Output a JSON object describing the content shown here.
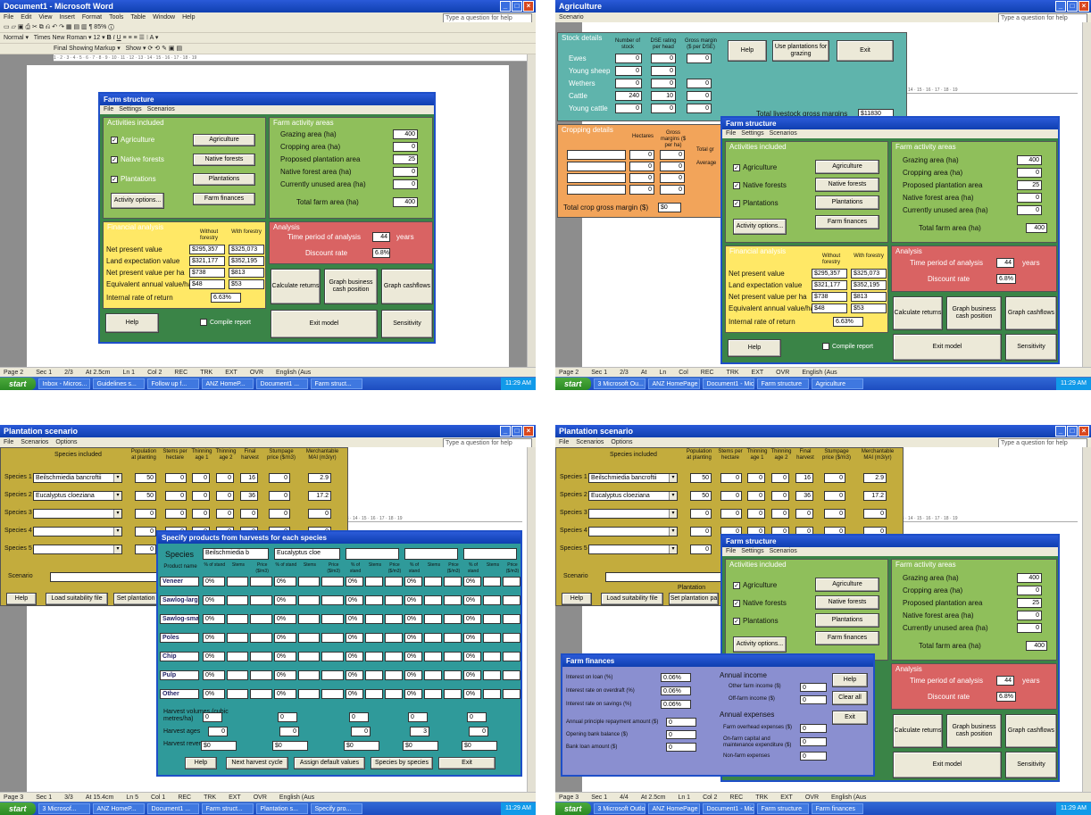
{
  "q1": {
    "title": "Document1 - Microsoft Word",
    "menu": [
      "File",
      "Edit",
      "View",
      "Insert",
      "Format",
      "Tools",
      "Table",
      "Window",
      "Help"
    ],
    "help_box": "Type a question for help",
    "toolbar_font": "Times New Roman",
    "toolbar_size": "12",
    "style": "Normal",
    "zoom": "85%",
    "markup": "Final Showing Markup",
    "show": "Show",
    "status": [
      "Page 2",
      "Sec 1",
      "2/3",
      "At 2.5cm",
      "Ln 1",
      "Col 2",
      "REC",
      "TRK",
      "EXT",
      "OVR",
      "English (Aus"
    ],
    "taskbar": [
      "start",
      "Inbox - Micros...",
      "Guidelines s...",
      "Follow up f...",
      "ANZ HomeP...",
      "Document1 ...",
      "Farm struct..."
    ],
    "clock": "11:29 AM"
  },
  "q2": {
    "title": "Agriculture",
    "scenario": "Scenario",
    "help_box": "Type a question for help",
    "stock_title": "Stock details",
    "stock_headers": [
      "Number of stock",
      "DSE rating per head",
      "Gross margin ($ per DSE)"
    ],
    "stock": [
      {
        "name": "Ewes",
        "v": [
          "0",
          "0",
          "0"
        ]
      },
      {
        "name": "Young sheep",
        "v": [
          "0",
          "0",
          ""
        ]
      },
      {
        "name": "Wethers",
        "v": [
          "0",
          "0",
          "0"
        ]
      },
      {
        "name": "Cattle",
        "v": [
          "240",
          "10",
          "0"
        ]
      },
      {
        "name": "Young cattle",
        "v": [
          "0",
          "0",
          "0"
        ]
      }
    ],
    "btn_help": "Help",
    "btn_use": "Use plantations for grazing",
    "btn_exit": "Exit",
    "total_livestock": "Total livestock gross margins",
    "total_livestock_val": "$11830",
    "crop_title": "Cropping details",
    "crop_headers": [
      "Hectares",
      "Gross margins ($ per ha)"
    ],
    "crop_rows": [
      [
        "0",
        "0"
      ],
      [
        "0",
        "0"
      ],
      [
        "0",
        "0"
      ],
      [
        "0",
        "0"
      ],
      [
        "0",
        "0"
      ]
    ],
    "total_crop": "Total crop gross margin ($)",
    "total_crop_val": "$0",
    "total_g": "Total gr",
    "average": "Average",
    "status": [
      "Page 2",
      "Sec 1",
      "2/3",
      "At",
      "Ln",
      "Col",
      "REC",
      "TRK",
      "EXT",
      "OVR",
      "English (Aus"
    ],
    "taskbar": [
      "start",
      "3 Microsoft Ou...",
      "ANZ HomePage ...",
      "Document1 - Mic...",
      "Farm structure",
      "Agriculture"
    ],
    "clock": "11:29 AM"
  },
  "farm": {
    "title": "Farm structure",
    "menu": [
      "File",
      "Settings",
      "Scenarios"
    ],
    "activities_title": "Activities included",
    "activities": [
      {
        "label": "Agriculture",
        "btn": "Agriculture"
      },
      {
        "label": "Native forests",
        "btn": "Native forests"
      },
      {
        "label": "Plantations",
        "btn": "Plantations"
      }
    ],
    "btn_options": "Activity options...",
    "btn_finances": "Farm finances",
    "areas_title": "Farm activity areas",
    "areas": [
      {
        "label": "Grazing area (ha)",
        "v": "400"
      },
      {
        "label": "Cropping area (ha)",
        "v": "0"
      },
      {
        "label": "Proposed plantation area",
        "v": "25"
      },
      {
        "label": "Native forest area (ha)",
        "v": "0"
      },
      {
        "label": "Currently unused area (ha)",
        "v": "0"
      }
    ],
    "total_area": "Total farm area (ha)",
    "total_area_v": "400",
    "fin_title": "Financial analysis",
    "fin_col1": "Without forestry",
    "fin_col2": "With forestry",
    "fin": [
      {
        "label": "Net present value",
        "a": "$295,357",
        "b": "$325,073"
      },
      {
        "label": "Land expectation value",
        "a": "$321,177",
        "b": "$352,195"
      },
      {
        "label": "Net present value per ha",
        "a": "$738",
        "b": "$813"
      },
      {
        "label": "Equivalent annual value/ha",
        "a": "$48",
        "b": "$53"
      }
    ],
    "irr_label": "Internal rate of return",
    "irr": "6.63%",
    "an_title": "Analysis",
    "period_label": "Time period of analysis",
    "period": "44",
    "period_unit": "years",
    "disc_label": "Discount rate",
    "disc": "6.8%",
    "btn_calc": "Calculate returns",
    "btn_graph": "Graph business cash position",
    "btn_cash": "Graph cashflows",
    "btn_help": "Help",
    "compile": "Compile report",
    "btn_exit": "Exit model",
    "btn_sens": "Sensitivity"
  },
  "q3": {
    "title": "Plantation scenario",
    "menu": [
      "File",
      "Scenarios",
      "Options"
    ],
    "help_box": "Type a question for help",
    "species_included": "Species included",
    "headers": [
      "Population at planting",
      "Stems per hectare",
      "Thinning age 1",
      "Thinning age 2",
      "Final harvest",
      "Stumpage price ($/m3)",
      "Merchantable MAI (m3/yr)"
    ],
    "species": [
      {
        "label": "Species 1",
        "name": "Beilschmiedia bancroftii",
        "v": [
          "50",
          "0",
          "0",
          "0",
          "16",
          "0",
          "2.9"
        ]
      },
      {
        "label": "Species 2",
        "name": "Eucalyptus cloeziana",
        "v": [
          "50",
          "0",
          "0",
          "0",
          "36",
          "0",
          "17.2"
        ]
      },
      {
        "label": "Species 3",
        "name": "",
        "v": [
          "0",
          "0",
          "0",
          "0",
          "0",
          "0",
          "0"
        ]
      },
      {
        "label": "Species 4",
        "name": "",
        "v": [
          "0",
          "0",
          "0",
          "0",
          "0",
          "0",
          "0"
        ]
      },
      {
        "label": "Species 5",
        "name": "",
        "v": [
          "0",
          "",
          "",
          "",
          "",
          "",
          ""
        ]
      }
    ],
    "scenario": "Scenario",
    "plantation": "Plantation",
    "btn_help": "Help",
    "btn_load": "Load suitability file",
    "btn_set": "Set plantation pa",
    "products": {
      "title": "Specify products from harvests for each species",
      "species_label": "Species",
      "sp1": "Beilschmiedia b",
      "sp2": "Eucalyptus cloe",
      "cols": [
        "Product name",
        "% of stand",
        "Stems",
        "Price ($/m3)"
      ],
      "rows": [
        {
          "name": "Veneer",
          "pct": "0%"
        },
        {
          "name": "Sawlog-larg",
          "pct": "0%"
        },
        {
          "name": "Sawlog-sma",
          "pct": "0%"
        },
        {
          "name": "Poles",
          "pct": "0%"
        },
        {
          "name": "Chip",
          "pct": "0%"
        },
        {
          "name": "Pulp",
          "pct": "0%"
        },
        {
          "name": "Other",
          "pct": "0%"
        }
      ],
      "hv_label": "Harvest volumes (cubic metres/ha)",
      "ages_label": "Harvest ages",
      "rev_label": "Harvest revenue",
      "hv": [
        "0",
        "0",
        "0",
        "0",
        "0"
      ],
      "ages": [
        "0",
        "0",
        "0",
        "3",
        "0"
      ],
      "rev": [
        "$0",
        "$0",
        "$0",
        "$0",
        "$0"
      ],
      "btns": [
        "Help",
        "Next harvest cycle",
        "Assign default values",
        "Species by species",
        "Exit"
      ]
    },
    "status": [
      "Page 3",
      "Sec 1",
      "3/3",
      "At 15.4cm",
      "Ln 5",
      "Col 1",
      "REC",
      "TRK",
      "EXT",
      "OVR",
      "English (Aus"
    ],
    "taskbar": [
      "start",
      "3 Microsof...",
      "ANZ HomeP...",
      "Document1 ...",
      "Farm struct...",
      "Plantation s...",
      "Specify pro..."
    ],
    "clock": "11:29 AM"
  },
  "q4": {
    "title": "Plantation scenario",
    "finances": {
      "title": "Farm finances",
      "left": [
        {
          "label": "Interest on loan (%)",
          "v": "0.06%"
        },
        {
          "label": "Interest rate on overdraft (%)",
          "v": "0.06%"
        },
        {
          "label": "Interest rate on savings (%)",
          "v": "0.06%"
        },
        {
          "label": "Annual principle repayment amount ($)",
          "v": "0"
        },
        {
          "label": "Opening bank balance ($)",
          "v": "0"
        },
        {
          "label": "Bank loan amount ($)",
          "v": "0"
        }
      ],
      "income_title": "Annual income",
      "income": [
        {
          "label": "Other farm income ($)",
          "v": "0"
        },
        {
          "label": "Off-farm income ($)",
          "v": "0"
        }
      ],
      "exp_title": "Annual expenses",
      "exp": [
        {
          "label": "Farm overhead expenses ($)",
          "v": "0"
        },
        {
          "label": "On-farm capital and maintenance expenditure ($)",
          "v": "0"
        },
        {
          "label": "Non-farm expenses",
          "v": "0"
        }
      ],
      "btn_help": "Help",
      "btn_clear": "Clear all",
      "btn_exit": "Exit"
    },
    "status": [
      "Page 3",
      "Sec 1",
      "4/4",
      "At 2.5cm",
      "Ln 1",
      "Col 2",
      "REC",
      "TRK",
      "EXT",
      "OVR",
      "English (Aus"
    ],
    "taskbar": [
      "start",
      "3 Microsoft Outlook",
      "ANZ HomePage - Mic...",
      "Document1 - Microsof...",
      "Farm structure",
      "Farm finances"
    ],
    "clock": "11:29 AM"
  }
}
